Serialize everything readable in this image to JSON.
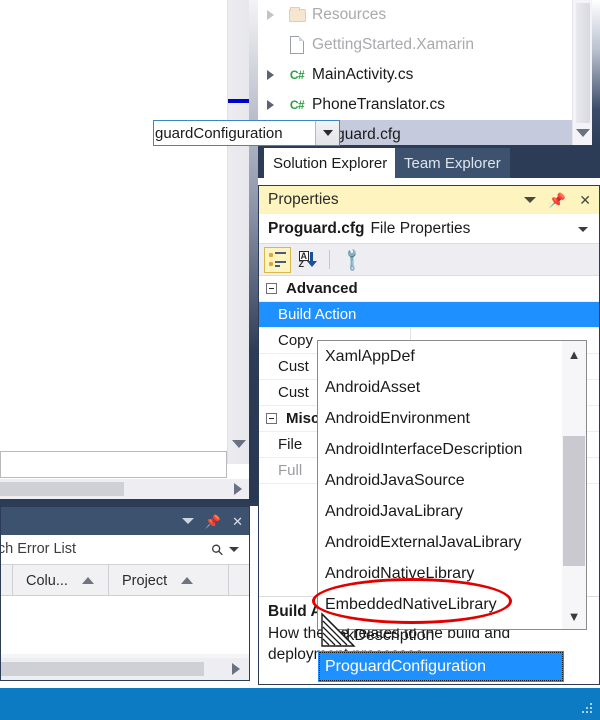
{
  "solution_explorer": {
    "items": [
      {
        "label": "Resources",
        "icon": "folder-icon",
        "expander": true,
        "dimmed": true,
        "selected": false
      },
      {
        "label": "GettingStarted.Xamarin",
        "icon": "file-icon",
        "expander": false,
        "dimmed": true,
        "selected": false
      },
      {
        "label": "MainActivity.cs",
        "icon": "csharp-icon",
        "expander": true,
        "dimmed": false,
        "selected": false
      },
      {
        "label": "PhoneTranslator.cs",
        "icon": "csharp-icon",
        "expander": true,
        "dimmed": false,
        "selected": false
      },
      {
        "label": "Proguard.cfg",
        "icon": "file-icon",
        "expander": false,
        "dimmed": false,
        "selected": true
      }
    ]
  },
  "tabs": [
    {
      "label": "Solution Explorer",
      "active": true
    },
    {
      "label": "Team Explorer",
      "active": false
    }
  ],
  "properties_panel": {
    "title": "Properties",
    "object_name": "Proguard.cfg",
    "object_type": "File Properties",
    "toolbar": {
      "categorized_label": "categorized-view",
      "alphabetical_label": "alphabetical-sort",
      "property_pages_label": "property-pages"
    },
    "grid": [
      {
        "kind": "category",
        "name": "Advanced"
      },
      {
        "kind": "property",
        "name": "Build Action",
        "selected": true,
        "dimmed": false
      },
      {
        "kind": "property",
        "name": "Copy",
        "selected": false,
        "dimmed": false
      },
      {
        "kind": "property",
        "name": "Cust",
        "selected": false,
        "dimmed": false
      },
      {
        "kind": "property",
        "name": "Cust",
        "selected": false,
        "dimmed": false
      },
      {
        "kind": "category",
        "name": "Misc"
      },
      {
        "kind": "property",
        "name": "File",
        "selected": false,
        "dimmed": false
      },
      {
        "kind": "property",
        "name": "Full",
        "selected": false,
        "dimmed": true
      }
    ],
    "combobox_value": "guardConfiguration",
    "dropdown_options": [
      {
        "label": "XamlAppDef",
        "selected": false
      },
      {
        "label": "AndroidAsset",
        "selected": false
      },
      {
        "label": "AndroidEnvironment",
        "selected": false
      },
      {
        "label": "AndroidInterfaceDescription",
        "selected": false
      },
      {
        "label": "AndroidJavaSource",
        "selected": false
      },
      {
        "label": "AndroidJavaLibrary",
        "selected": false
      },
      {
        "label": "AndroidExternalJavaLibrary",
        "selected": false
      },
      {
        "label": "AndroidNativeLibrary",
        "selected": false
      },
      {
        "label": "EmbeddedNativeLibrary",
        "selected": false
      },
      {
        "label": "LinkDescription",
        "selected": false
      },
      {
        "label": "ProguardConfiguration",
        "selected": true
      }
    ],
    "description": {
      "heading": "Build A",
      "body": "How the file relates to the build and deployment processes."
    }
  },
  "error_list": {
    "search_placeholder": "arch Error List",
    "columns": [
      {
        "label": "Colu...",
        "sorted": true
      },
      {
        "label": "Project",
        "sorted": true
      }
    ]
  },
  "colors": {
    "accent_blue": "#1e90ff",
    "titlebar_yellow": "#fdf4bf",
    "panel_dark": "#2d3c56",
    "annotation_red": "#e10000",
    "taskbar_blue": "#0d7ac4"
  }
}
